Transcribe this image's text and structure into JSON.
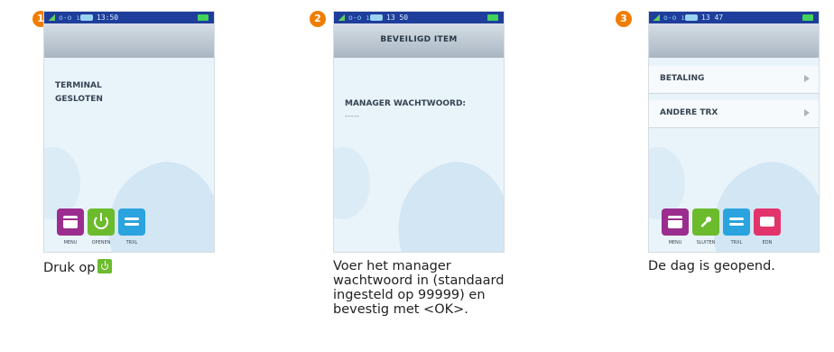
{
  "steps": [
    {
      "number": "1",
      "status_time": "13:50",
      "header_title": "",
      "screen_lines": [
        "TERMINAL",
        "GESLOTEN"
      ],
      "buttons": [
        {
          "label": "MENU",
          "icon": "menu-icon",
          "color": "#9b2d8e"
        },
        {
          "label": "OPENEN",
          "icon": "power-icon",
          "color": "#6cbb2d"
        },
        {
          "label": "TRXL",
          "icon": "wave-icon",
          "color": "#2aa3de"
        }
      ],
      "caption": "Druk op"
    },
    {
      "number": "2",
      "status_time": "13 50",
      "header_title": "BEVEILIGD ITEM",
      "screen_lines": [
        "MANAGER WACHTWOORD:",
        "-----"
      ],
      "buttons": [],
      "caption": "Voer het manager wachtwoord in (standaard ingesteld op 99999) en bevestig met <OK>."
    },
    {
      "number": "3",
      "status_time": "13 47",
      "header_title": "",
      "menu_items": [
        "BETALING",
        "ANDERE TRX"
      ],
      "buttons": [
        {
          "label": "MENU",
          "icon": "menu-icon",
          "color": "#9b2d8e"
        },
        {
          "label": "SLUITEN",
          "icon": "key-icon",
          "color": "#6cbb2d"
        },
        {
          "label": "TRXL",
          "icon": "wave-icon",
          "color": "#2aa3de"
        },
        {
          "label": "EDN",
          "icon": "print-icon",
          "color": "#e2336b"
        }
      ],
      "caption": "De dag is geopend."
    }
  ],
  "status_net": "o-o ı"
}
